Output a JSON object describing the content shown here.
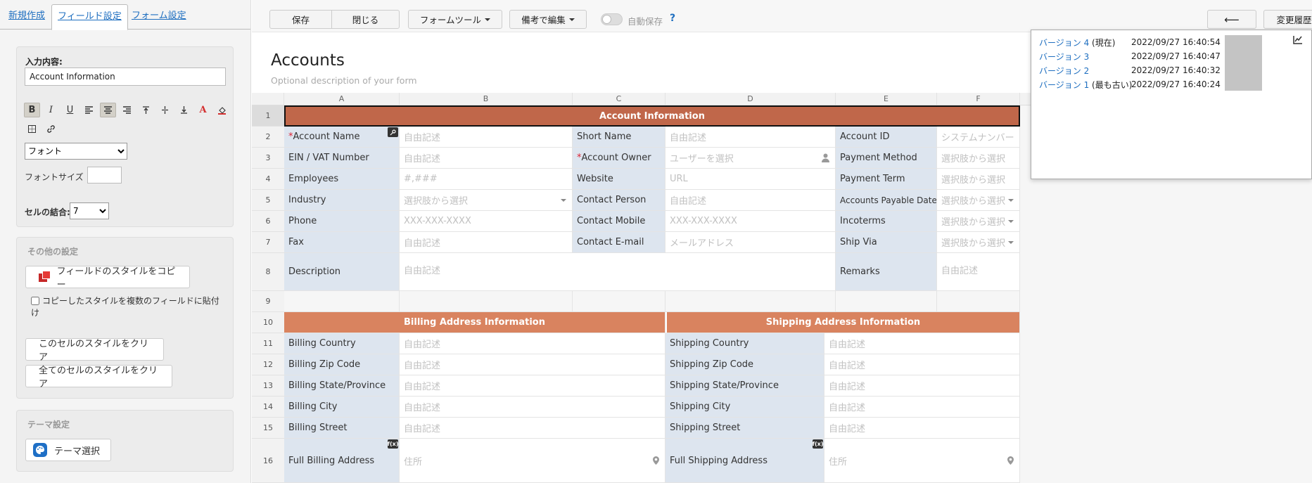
{
  "tabs": [
    {
      "label": "新規作成"
    },
    {
      "label": "フィールド設定"
    },
    {
      "label": "フォーム設定"
    }
  ],
  "input_panel": {
    "label": "入力内容:",
    "value": "Account Information",
    "font_select": "フォント",
    "font_size_label": "フォントサイズ",
    "merge_label": "セルの結合:",
    "merge_value": "7"
  },
  "other_panel": {
    "title": "その他の設定",
    "copy_style": "フィールドのスタイルをコピー",
    "multi_paste": "コピーしたスタイルを複数のフィールドに貼付け",
    "clear_cell": "このセルのスタイルをクリア",
    "clear_all": "全てのセルのスタイルをクリア"
  },
  "theme_panel": {
    "title": "テーマ設定",
    "button": "テーマ選択"
  },
  "toolbar": {
    "save": "保存",
    "close": "閉じる",
    "form_tools": "フォームツール",
    "note_edit": "備考で編集",
    "autosave": "自動保存",
    "help": "?",
    "back": "⟵",
    "history": "変更履歴"
  },
  "form": {
    "title": "Accounts",
    "description": "Optional description of your form"
  },
  "columns": [
    "A",
    "B",
    "C",
    "D",
    "E",
    "F"
  ],
  "rows": [
    "1",
    "2",
    "3",
    "4",
    "5",
    "6",
    "7",
    "8",
    "9",
    "10",
    "11",
    "12",
    "13",
    "14",
    "15",
    "16"
  ],
  "sections": {
    "account": "Account Information",
    "billing": "Billing Address Information",
    "shipping": "Shipping Address Information"
  },
  "fields": {
    "account_name": "Account Name",
    "short_name": "Short Name",
    "account_id": "Account ID",
    "ein": "EIN / VAT Number",
    "account_owner": "Account Owner",
    "payment_method": "Payment Method",
    "employees": "Employees",
    "website": "Website",
    "payment_term": "Payment Term",
    "industry": "Industry",
    "contact_person": "Contact Person",
    "ap_date": "Accounts Payable Date",
    "phone": "Phone",
    "contact_mobile": "Contact Mobile",
    "incoterms": "Incoterms",
    "fax": "Fax",
    "contact_email": "Contact E-mail",
    "ship_via": "Ship Via",
    "description": "Description",
    "remarks": "Remarks",
    "billing_country": "Billing Country",
    "billing_zip": "Billing Zip Code",
    "billing_state": "Billing State/Province",
    "billing_city": "Billing City",
    "billing_street": "Billing Street",
    "full_billing": "Full Billing Address",
    "shipping_country": "Shipping Country",
    "shipping_zip": "Shipping Zip Code",
    "shipping_state": "Shipping State/Province",
    "shipping_city": "Shipping City",
    "shipping_street": "Shipping Street",
    "full_shipping": "Full Shipping Address"
  },
  "placeholders": {
    "free": "自由記述",
    "system_number": "システムナンバー",
    "select_user": "ユーザーを選択",
    "select_option": "選択肢から選択",
    "number": "#,###",
    "url": "URL",
    "phone": "XXX-XXX-XXXX",
    "email": "メールアドレス",
    "address": "住所",
    "fx": "f(x)"
  },
  "history": [
    {
      "version": "バージョン 4",
      "note": "(現在)",
      "time": "2022/09/27 16:40:54"
    },
    {
      "version": "バージョン 3",
      "note": "",
      "time": "2022/09/27 16:40:47"
    },
    {
      "version": "バージョン 2",
      "note": "",
      "time": "2022/09/27 16:40:32"
    },
    {
      "version": "バージョン 1",
      "note": "(最も古い)",
      "time": "2022/09/27 16:40:24"
    }
  ],
  "colors": {
    "section_main": "#c0674a",
    "section_sub": "#d9835f",
    "label_bg": "#dde5ef",
    "link": "#1f6fc0"
  }
}
